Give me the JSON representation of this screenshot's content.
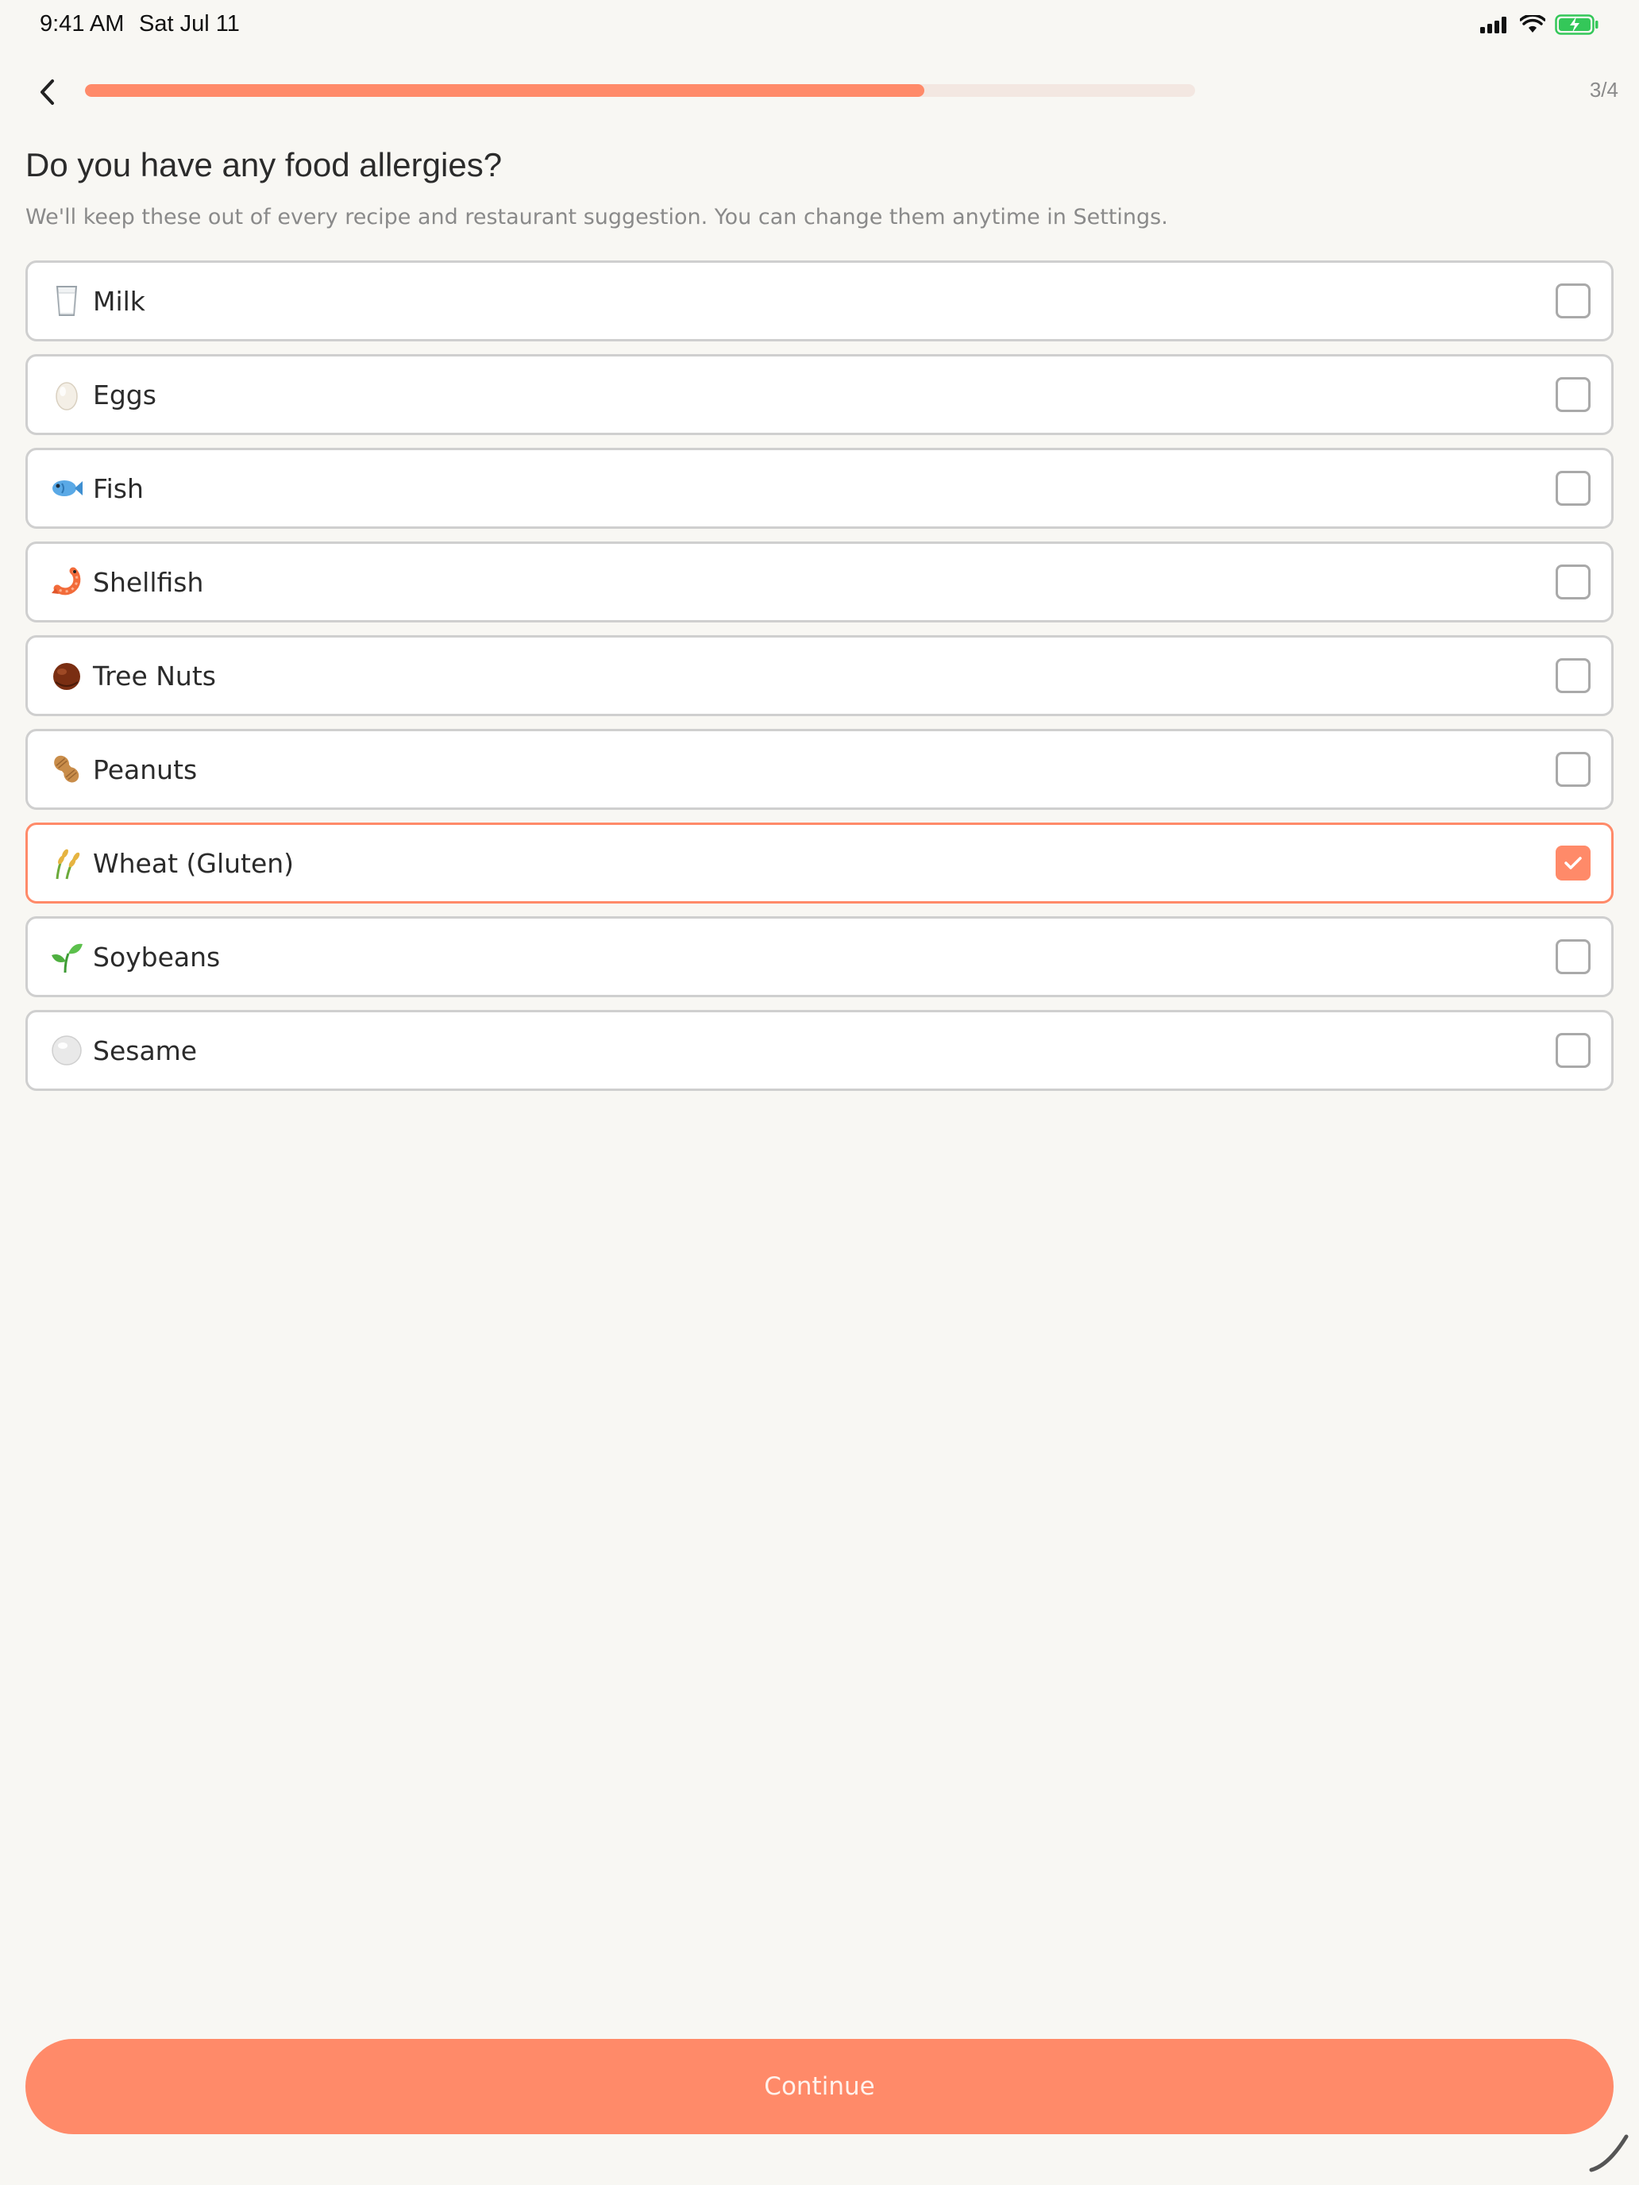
{
  "status_bar": {
    "time": "9:41 AM",
    "date": "Sat Jul 11",
    "icons": [
      "signal-icon",
      "wifi-icon",
      "battery-charging-icon"
    ],
    "battery_color": "#34C759"
  },
  "header": {
    "back_icon": "chevron-left-icon",
    "step": "3/4",
    "progress_fraction": 0.75,
    "accent_color": "#FF8A69"
  },
  "question": {
    "title": "Do you have any food allergies?",
    "subtitle": "We'll keep these out of every recipe and restaurant suggestion. You can change them anytime in Settings."
  },
  "options": [
    {
      "label": "Milk",
      "icon": "milk-glass-icon",
      "selected": false
    },
    {
      "label": "Eggs",
      "icon": "egg-icon",
      "selected": false
    },
    {
      "label": "Fish",
      "icon": "fish-icon",
      "selected": false
    },
    {
      "label": "Shellfish",
      "icon": "shrimp-icon",
      "selected": false
    },
    {
      "label": "Tree Nuts",
      "icon": "chestnut-icon",
      "selected": false
    },
    {
      "label": "Peanuts",
      "icon": "peanut-icon",
      "selected": false
    },
    {
      "label": "Wheat (Gluten)",
      "icon": "wheat-icon",
      "selected": true
    },
    {
      "label": "Soybeans",
      "icon": "seedling-icon",
      "selected": false
    },
    {
      "label": "Sesame",
      "icon": "sesame-icon",
      "selected": false
    }
  ],
  "footer": {
    "continue_label": "Continue"
  }
}
